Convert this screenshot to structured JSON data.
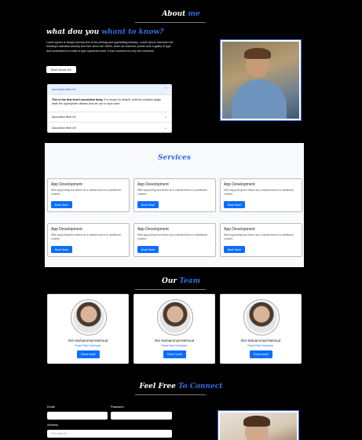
{
  "about": {
    "heading_main": "About",
    "heading_accent": "me",
    "question_main": "what dou you",
    "question_accent": "whant to know?",
    "body_text": "Lorem Ipsum is simply dummy text of the printing and typesetting industry. Lorem Ipsum has been the industry's standard dummy text ever since the 1500s, when an unknown printer took a galley of type and scrambled it to make a type specimen book. It has survived not only five centuries",
    "button_label": "More About me!",
    "photo_icon": "portrait-photo"
  },
  "accordion": {
    "items": [
      {
        "label": "Accordion Item #1",
        "expanded": true,
        "body_bold": "This is the first item's accordion body.",
        "body_rest": " It is shown by default, until the collapse plugin adds the appropriate classes that we use to style each"
      },
      {
        "label": "Accordion Item #2",
        "expanded": false
      },
      {
        "label": "Accordion Item #3",
        "expanded": false
      }
    ]
  },
  "services": {
    "heading": "Services",
    "cards": [
      {
        "title": "App Development",
        "text": "With supporting text below as a natural lead-in to additional content.",
        "button": "Book Now!"
      },
      {
        "title": "App Development",
        "text": "With supporting text below as a natural lead-in to additional content.",
        "button": "Book Now!"
      },
      {
        "title": "App Development",
        "text": "With supporting text below as a natural lead-in to additional content.",
        "button": "Book Now!"
      },
      {
        "title": "App Development",
        "text": "With supporting text below as a natural lead-in to additional content.",
        "button": "Book Now!"
      },
      {
        "title": "App Development",
        "text": "With supporting text below as a natural lead-in to additional content.",
        "button": "Book Now!"
      },
      {
        "title": "App Development",
        "text": "With supporting text below as a natural lead-in to additional content.",
        "button": "Book Now!"
      }
    ]
  },
  "team": {
    "heading_main": "Our",
    "heading_accent": "Team",
    "members": [
      {
        "name": "Rizi-Muhammad-Mehsud",
        "role": "React Rest Developer",
        "button": "Read more!"
      },
      {
        "name": "Rizi-Muhammad-Mehsud",
        "role": "React Rest Developer",
        "button": "Read more!"
      },
      {
        "name": "Rizi-Muhammad-Mehsud",
        "role": "React Rest Developer",
        "button": "Read more!"
      }
    ]
  },
  "contact": {
    "heading_main": "Feel Free",
    "heading_accent": "To Connect",
    "email_label": "Email",
    "password_label": "Password",
    "address_label": "Address",
    "address_placeholder": "1234 Main St"
  },
  "colors": {
    "accent": "#2f6fe0",
    "button_primary": "#0d6efd",
    "page_background": "#000000",
    "services_background": "#f8f9fa"
  }
}
